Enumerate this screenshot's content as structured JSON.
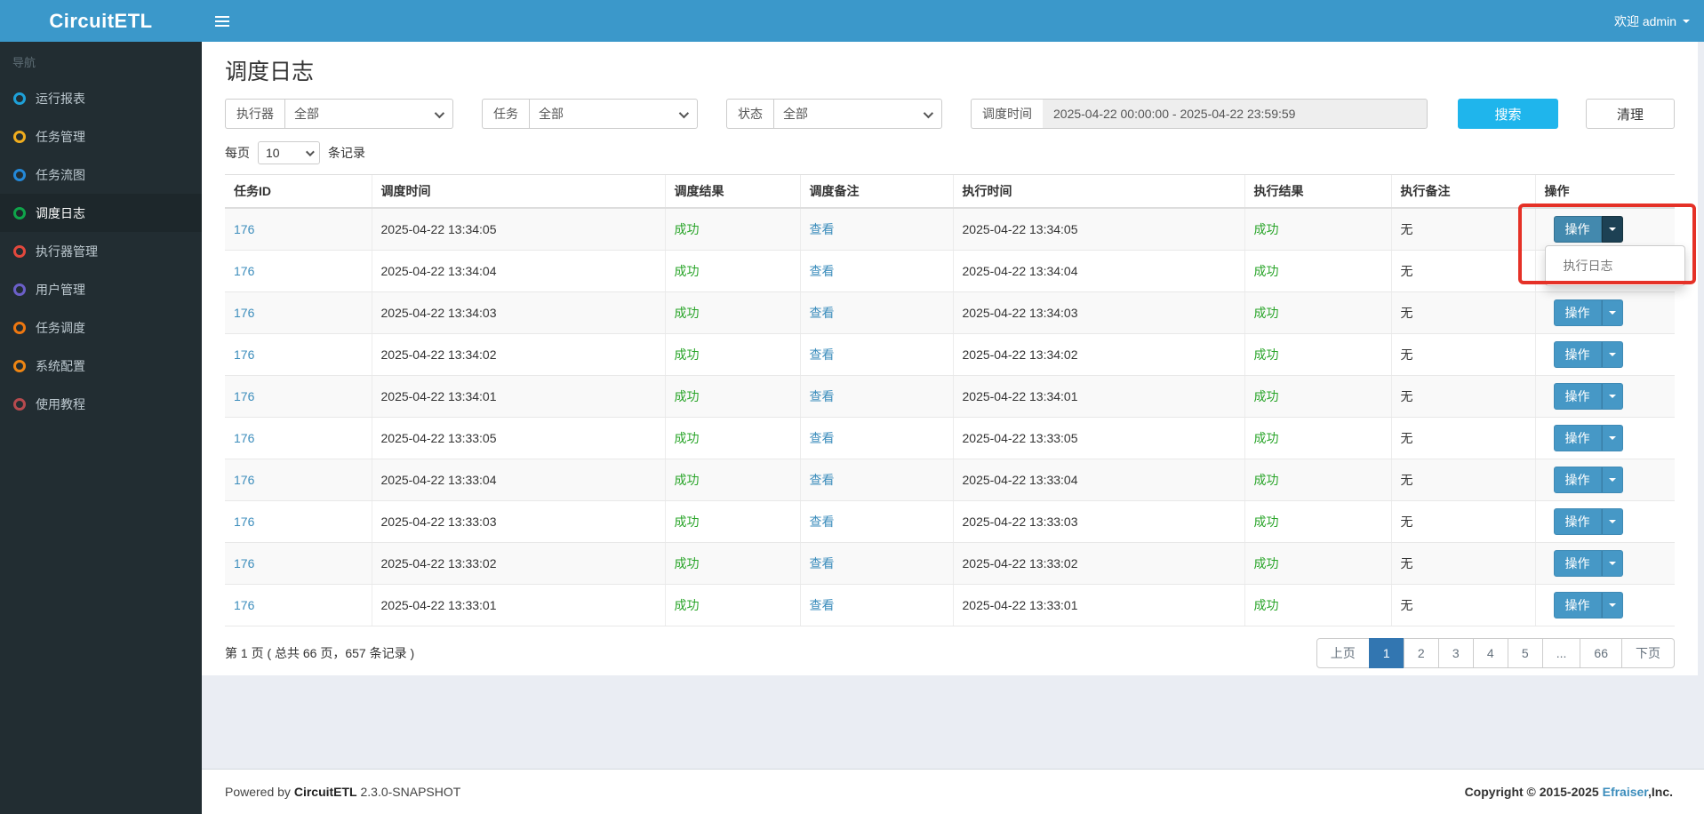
{
  "topbar": {
    "logo": "CircuitETL",
    "welcome": "欢迎 admin"
  },
  "sidebar": {
    "nav_label": "导航",
    "items": [
      {
        "label": "运行报表",
        "color": "#1ea0d8",
        "active": false
      },
      {
        "label": "任务管理",
        "color": "#f0ad1e",
        "active": false
      },
      {
        "label": "任务流图",
        "color": "#2488d8",
        "active": false
      },
      {
        "label": "调度日志",
        "color": "#0fa44a",
        "active": true
      },
      {
        "label": "执行器管理",
        "color": "#e2483d",
        "active": false
      },
      {
        "label": "用户管理",
        "color": "#6b5fc8",
        "active": false
      },
      {
        "label": "任务调度",
        "color": "#ee7710",
        "active": false
      },
      {
        "label": "系统配置",
        "color": "#ee8513",
        "active": false
      },
      {
        "label": "使用教程",
        "color": "#b64a4e",
        "active": false
      }
    ]
  },
  "page": {
    "title": "调度日志"
  },
  "filters": {
    "executor": {
      "label": "执行器",
      "value": "全部"
    },
    "job": {
      "label": "任务",
      "value": "全部"
    },
    "status": {
      "label": "状态",
      "value": "全部"
    },
    "time": {
      "label": "调度时间",
      "value": "2025-04-22 00:00:00 - 2025-04-22 23:59:59"
    },
    "search_label": "搜索",
    "clear_label": "清理"
  },
  "page_size": {
    "prefix": "每页",
    "value": "10",
    "suffix": "条记录"
  },
  "table": {
    "headers": [
      "任务ID",
      "调度时间",
      "调度结果",
      "调度备注",
      "执行时间",
      "执行结果",
      "执行备注",
      "操作"
    ],
    "view_label": "查看",
    "action_label": "操作",
    "dropdown_item": "执行日志",
    "rows": [
      {
        "job_id": "176",
        "sched_time": "2025-04-22 13:34:05",
        "sched_result": "成功",
        "exec_time": "2025-04-22 13:34:05",
        "exec_result": "成功",
        "exec_remark": "无"
      },
      {
        "job_id": "176",
        "sched_time": "2025-04-22 13:34:04",
        "sched_result": "成功",
        "exec_time": "2025-04-22 13:34:04",
        "exec_result": "成功",
        "exec_remark": "无"
      },
      {
        "job_id": "176",
        "sched_time": "2025-04-22 13:34:03",
        "sched_result": "成功",
        "exec_time": "2025-04-22 13:34:03",
        "exec_result": "成功",
        "exec_remark": "无"
      },
      {
        "job_id": "176",
        "sched_time": "2025-04-22 13:34:02",
        "sched_result": "成功",
        "exec_time": "2025-04-22 13:34:02",
        "exec_result": "成功",
        "exec_remark": "无"
      },
      {
        "job_id": "176",
        "sched_time": "2025-04-22 13:34:01",
        "sched_result": "成功",
        "exec_time": "2025-04-22 13:34:01",
        "exec_result": "成功",
        "exec_remark": "无"
      },
      {
        "job_id": "176",
        "sched_time": "2025-04-22 13:33:05",
        "sched_result": "成功",
        "exec_time": "2025-04-22 13:33:05",
        "exec_result": "成功",
        "exec_remark": "无"
      },
      {
        "job_id": "176",
        "sched_time": "2025-04-22 13:33:04",
        "sched_result": "成功",
        "exec_time": "2025-04-22 13:33:04",
        "exec_result": "成功",
        "exec_remark": "无"
      },
      {
        "job_id": "176",
        "sched_time": "2025-04-22 13:33:03",
        "sched_result": "成功",
        "exec_time": "2025-04-22 13:33:03",
        "exec_result": "成功",
        "exec_remark": "无"
      },
      {
        "job_id": "176",
        "sched_time": "2025-04-22 13:33:02",
        "sched_result": "成功",
        "exec_time": "2025-04-22 13:33:02",
        "exec_result": "成功",
        "exec_remark": "无"
      },
      {
        "job_id": "176",
        "sched_time": "2025-04-22 13:33:01",
        "sched_result": "成功",
        "exec_time": "2025-04-22 13:33:01",
        "exec_result": "成功",
        "exec_remark": "无"
      }
    ]
  },
  "pagination": {
    "summary": "第 1 页 ( 总共 66 页，657 条记录 )",
    "prev_label": "上页",
    "next_label": "下页",
    "pages": [
      "1",
      "2",
      "3",
      "4",
      "5",
      "...",
      "66"
    ],
    "active": "1"
  },
  "footer": {
    "powered_prefix": "Powered by",
    "brand": "CircuitETL",
    "version": "2.3.0-SNAPSHOT",
    "copyright": "Copyright © 2015-2025",
    "company": "Efraiser",
    "company_suffix": ",Inc."
  },
  "colors": {
    "topbar_blue": "#3b98ca",
    "sidebar_dark": "#222d32",
    "link_blue": "#3c8dbc",
    "success_green": "#28a428",
    "search_cyan": "#1fb5ec",
    "action_button_blue": "#4698c6",
    "active_page_blue": "#3276b1",
    "annotation_red": "#e53127",
    "content_bg": "#eaedf3"
  }
}
